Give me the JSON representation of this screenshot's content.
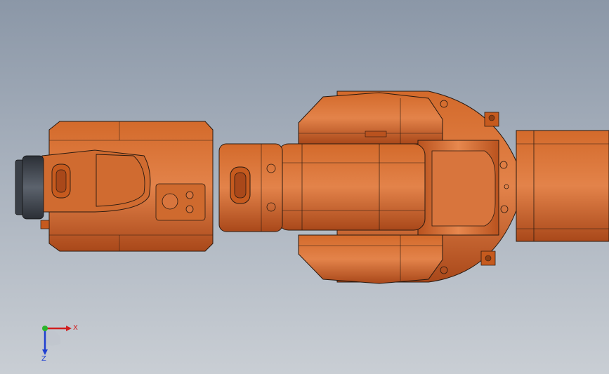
{
  "viewport": {
    "background_top": "#8b97a7",
    "background_bottom": "#c9ced4"
  },
  "model": {
    "body_color": "#c65a1e",
    "highlight_color": "#e07a3c",
    "shadow_color": "#8e3f14",
    "edge_color": "#2a1a10",
    "flange_color": "#3a3f47"
  },
  "triad": {
    "x_label": "X",
    "z_label": "Z",
    "x_color": "#d11f1f",
    "y_color": "#2bb52b",
    "z_color": "#1f3fd1"
  }
}
